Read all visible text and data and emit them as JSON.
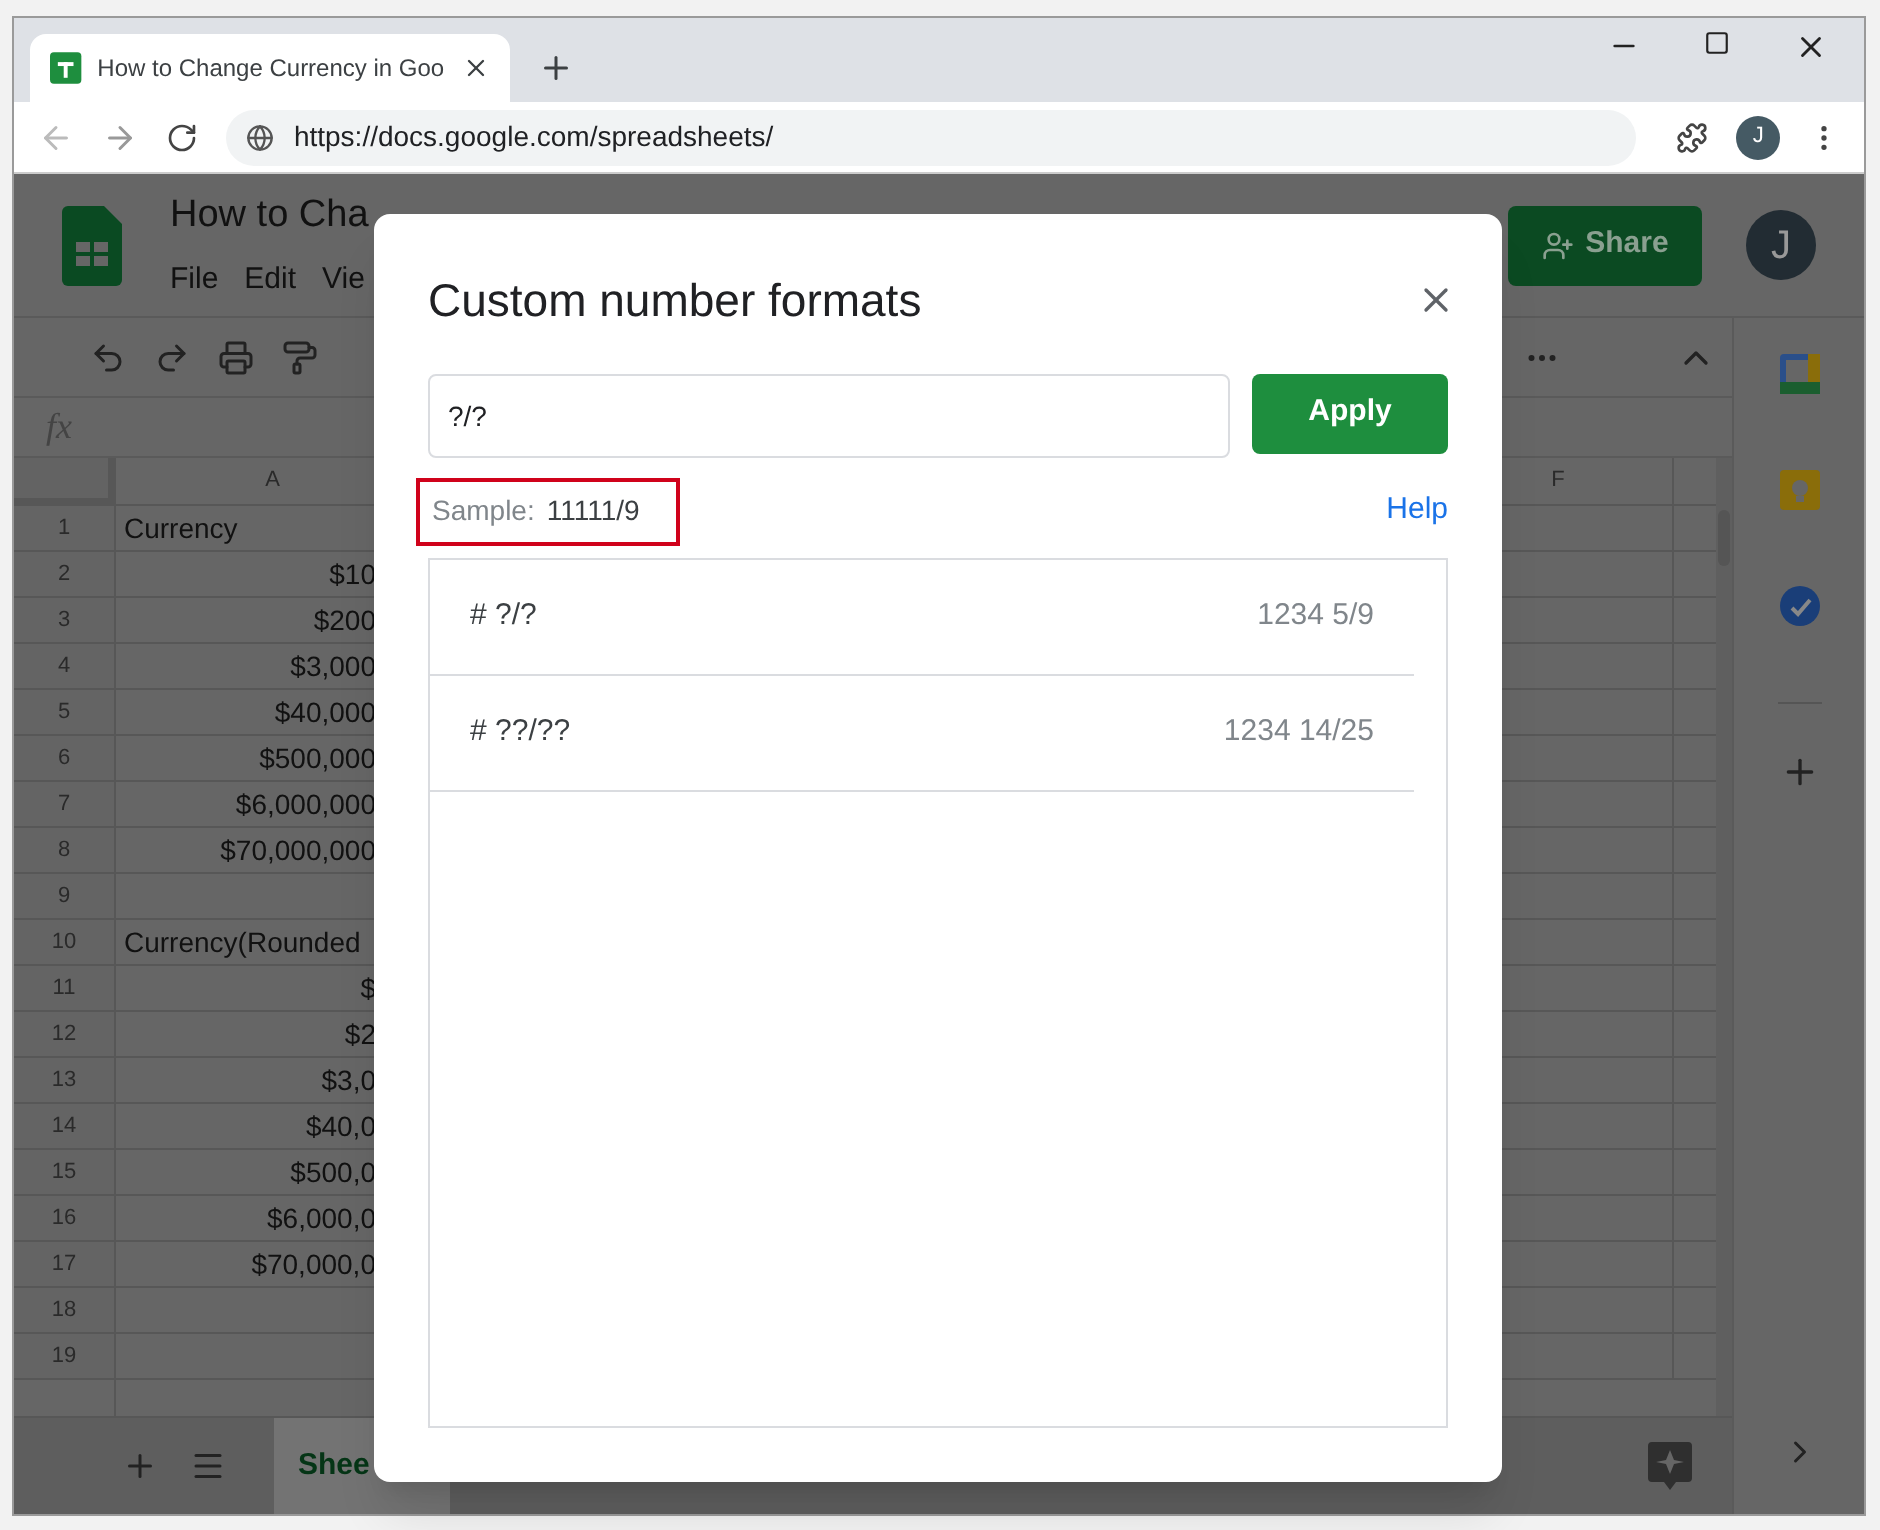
{
  "browser": {
    "tab_title": "How to Change Currency in Goo",
    "url": "https://docs.google.com/spreadsheets/",
    "profile_initial": "J"
  },
  "doc": {
    "title": "How to Cha",
    "menu": [
      "File",
      "Edit",
      "Vie"
    ],
    "share": "Share",
    "avatar": "J"
  },
  "formula_bar": {
    "label": "fx"
  },
  "sheet": {
    "columns": [
      "A",
      "F"
    ],
    "rows": [
      {
        "number": "1",
        "kind": "label",
        "value": "Currency"
      },
      {
        "number": "2",
        "kind": "amount",
        "value": "$10"
      },
      {
        "number": "3",
        "kind": "amount",
        "value": "$200"
      },
      {
        "number": "4",
        "kind": "amount",
        "value": "$3,000"
      },
      {
        "number": "5",
        "kind": "amount",
        "value": "$40,000"
      },
      {
        "number": "6",
        "kind": "amount",
        "value": "$500,000"
      },
      {
        "number": "7",
        "kind": "amount",
        "value": "$6,000,000"
      },
      {
        "number": "8",
        "kind": "amount",
        "value": "$70,000,000"
      },
      {
        "number": "9",
        "kind": "amount",
        "value": ""
      },
      {
        "number": "10",
        "kind": "label",
        "value": "Currency(Rounded"
      },
      {
        "number": "11",
        "kind": "amount",
        "value": "$"
      },
      {
        "number": "12",
        "kind": "amount",
        "value": "$2"
      },
      {
        "number": "13",
        "kind": "amount",
        "value": "$3,0"
      },
      {
        "number": "14",
        "kind": "amount",
        "value": "$40,0"
      },
      {
        "number": "15",
        "kind": "amount",
        "value": "$500,0"
      },
      {
        "number": "16",
        "kind": "amount",
        "value": "$6,000,0"
      },
      {
        "number": "17",
        "kind": "amount",
        "value": "$70,000,0"
      },
      {
        "number": "18",
        "kind": "amount",
        "value": ""
      },
      {
        "number": "19",
        "kind": "amount",
        "value": ""
      }
    ],
    "sheet_tab": "Shee"
  },
  "dialog": {
    "title": "Custom number formats",
    "input_value": "?/?",
    "apply": "Apply",
    "sample": {
      "label": "Sample:",
      "value": "11111/9",
      "highlighted": true
    },
    "help": "Help",
    "formats": [
      {
        "pattern": "# ?/?",
        "example": "1234 5/9"
      },
      {
        "pattern": "# ??/??",
        "example": "1234 14/25"
      }
    ]
  }
}
